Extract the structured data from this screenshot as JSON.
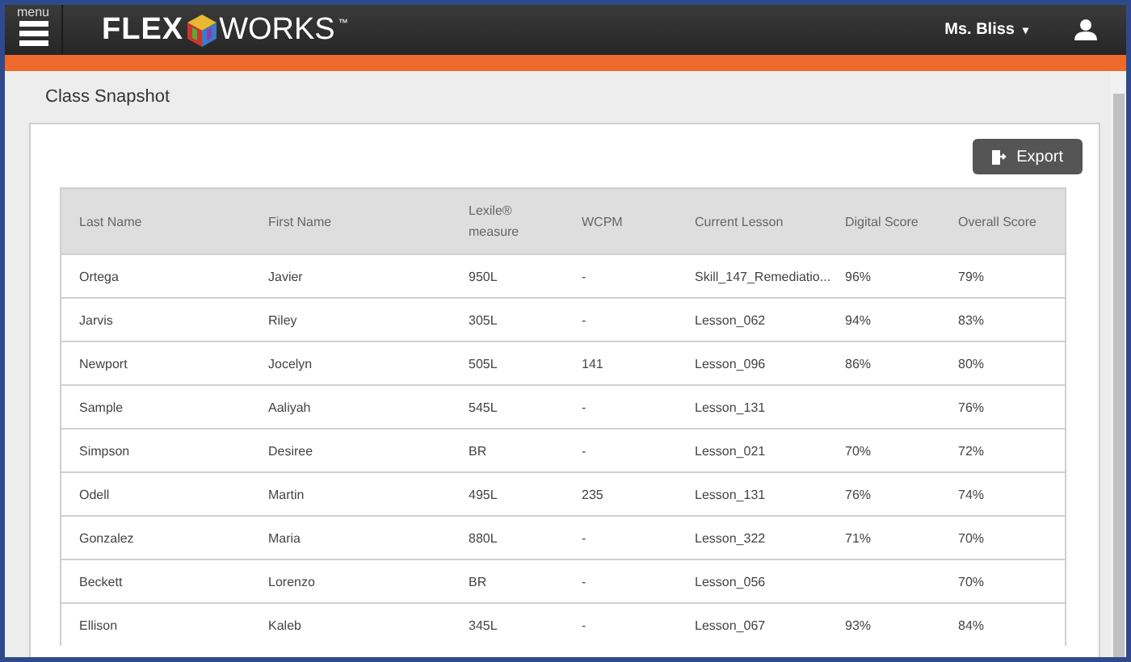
{
  "header": {
    "menu_label": "menu",
    "logo_left": "FLEX",
    "logo_right": "WORKS",
    "logo_mark": "™",
    "user": "Ms. Bliss",
    "user_caret": "▾"
  },
  "page_title": "Class Snapshot",
  "export_button": "Export",
  "table": {
    "columns": [
      "Last Name",
      "First Name",
      "Lexile® measure",
      "WCPM",
      "Current Lesson",
      "Digital Score",
      "Overall Score"
    ],
    "rows": [
      {
        "last_name": "Ortega",
        "first_name": "Javier",
        "lexile": "950L",
        "wcpm": "-",
        "lesson": "Skill_147_Remediatio...",
        "digital_score": "96%",
        "overall_score": "79%"
      },
      {
        "last_name": "Jarvis",
        "first_name": "Riley",
        "lexile": "305L",
        "wcpm": "-",
        "lesson": "Lesson_062",
        "digital_score": "94%",
        "overall_score": "83%"
      },
      {
        "last_name": "Newport",
        "first_name": "Jocelyn",
        "lexile": "505L",
        "wcpm": "141",
        "lesson": "Lesson_096",
        "digital_score": "86%",
        "overall_score": "80%"
      },
      {
        "last_name": "Sample",
        "first_name": "Aaliyah",
        "lexile": "545L",
        "wcpm": "-",
        "lesson": "Lesson_131",
        "overall_score": "76%"
      },
      {
        "last_name": "Simpson",
        "first_name": "Desiree",
        "lexile": "BR",
        "wcpm": "-",
        "lesson": "Lesson_021",
        "digital_score": "70%",
        "overall_score": "72%"
      },
      {
        "last_name": "Odell",
        "first_name": "Martin",
        "lexile": "495L",
        "wcpm": "235",
        "lesson": "Lesson_131",
        "digital_score": "76%",
        "overall_score": "74%"
      },
      {
        "last_name": "Gonzalez",
        "first_name": "Maria",
        "lexile": "880L",
        "wcpm": "-",
        "lesson": "Lesson_322",
        "digital_score": "71%",
        "overall_score": "70%"
      },
      {
        "last_name": "Beckett",
        "first_name": "Lorenzo",
        "lexile": "BR",
        "wcpm": "-",
        "lesson": "Lesson_056",
        "overall_score": "70%"
      },
      {
        "last_name": "Ellison",
        "first_name": "Kaleb",
        "lexile": "345L",
        "wcpm": "-",
        "lesson": "Lesson_067",
        "digital_score": "93%",
        "overall_score": "84%"
      }
    ]
  }
}
